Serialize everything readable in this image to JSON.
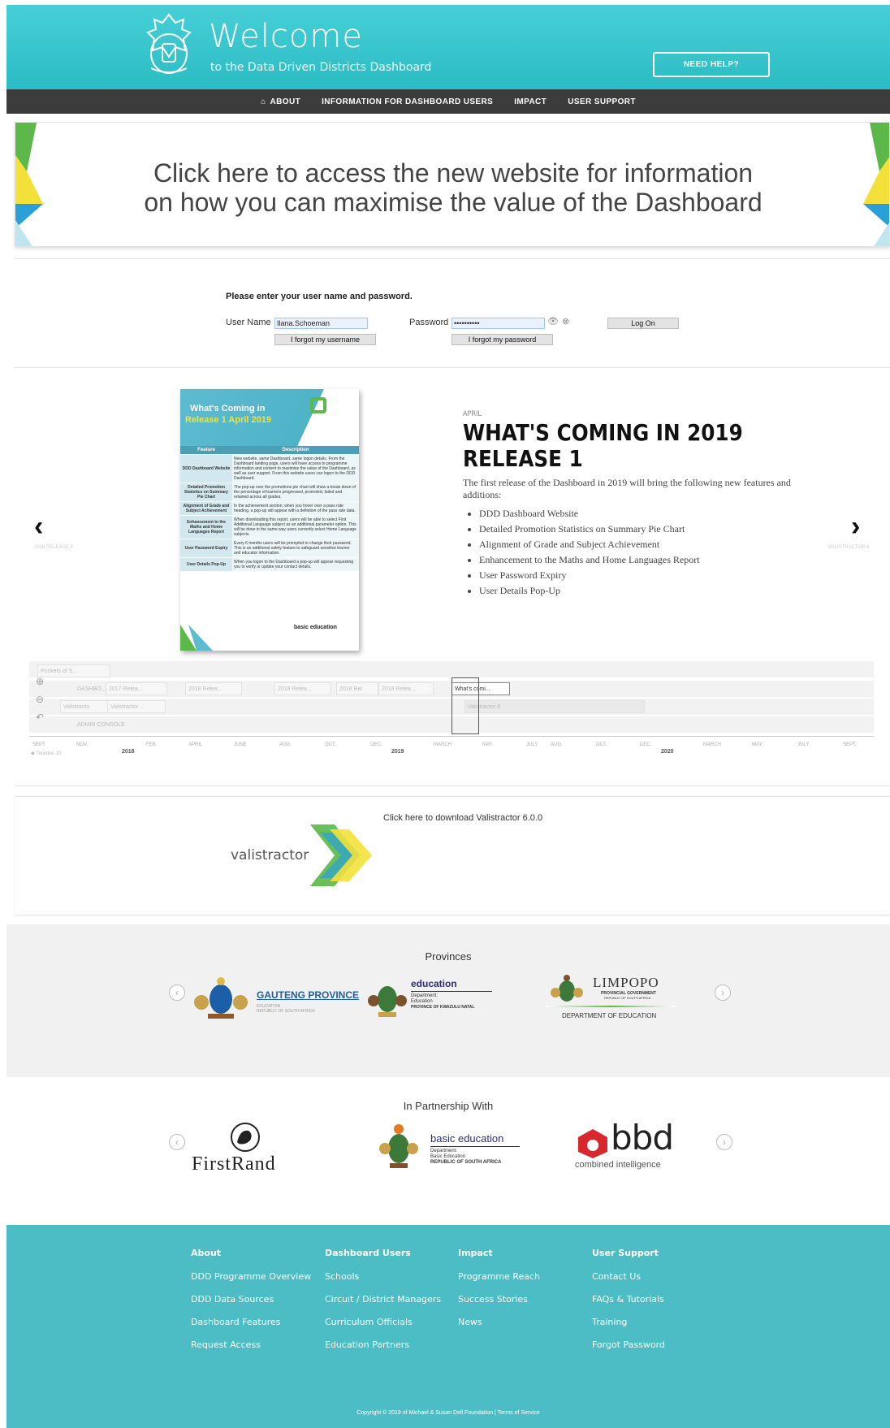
{
  "header": {
    "title": "Welcome",
    "subtitle": "to the Data Driven Districts Dashboard",
    "help_button": "NEED HELP?"
  },
  "nav": [
    "ABOUT",
    "INFORMATION FOR DASHBOARD USERS",
    "IMPACT",
    "USER SUPPORT"
  ],
  "banner": {
    "line1": "Click here to access the new website for information",
    "line2": "on how you can maximise the value of the Dashboard"
  },
  "login": {
    "prompt": "Please enter your user name and password.",
    "username_label": "User Name",
    "username_value": "Ilana.Schoeman",
    "password_label": "Password",
    "password_value": "••••••••••",
    "forgot_username": "I forgot my username",
    "forgot_password": "I forgot my password",
    "logon": "Log On"
  },
  "slide": {
    "date": "APRIL",
    "title": "WHAT'S COMING IN 2019 RELEASE 1",
    "intro": "The first release of the Dashboard in 2019 will bring the following new features and additions:",
    "items": [
      "DDD Dashboard Website",
      "Detailed Promotion Statistics on Summary Pie Chart",
      "Alignment of Grade and Subject Achievement",
      "Enhancement to the Maths and Home Languages Report",
      "User Password Expiry",
      "User Details Pop-Up"
    ],
    "prev_caption": "2018 RELEASE 3",
    "next_caption": "VALISTRACTOR 6",
    "prev_icon": "chevron-left",
    "next_icon": "chevron-right",
    "poster": {
      "title1": "What's Coming in",
      "title2": "Release 1 April 2019",
      "col1": "Feature",
      "col2": "Description",
      "rows": [
        {
          "f": "DDD Dashboard Website",
          "d": "New website, same Dashboard, same logon details. From the Dashboard landing page, users will have access to programme information and content to maximise the value of the Dashboard, as well as user support. From this website users can logon to the DDD Dashboard."
        },
        {
          "f": "Detailed Promotion Statistics on Summary Pie Chart",
          "d": "The pop-up over the promotions pie chart will show a break down of the percentage of learners progressed, promoted, failed and retained across all grades."
        },
        {
          "f": "Alignment of Grade and Subject Achievement",
          "d": "In the achievement section, when you hover over a pass rate heading, a pop-up will appear with a definition of the pass rate data."
        },
        {
          "f": "Enhancement to the Maths and Home Languages Report",
          "d": "When downloading this report, users will be able to select First Additional Language subject as an additional parameter option. This will be done in the same way users currently select Home Language subjects."
        },
        {
          "f": "User Password Expiry",
          "d": "Every 6 months users will be prompted to change their password. This is an additional safety feature to safeguard sensitive learner and educator information."
        },
        {
          "f": "User Details Pop-Up",
          "d": "When you logon to the Dashboard a pop-up will appear requesting you to verify or update your contact details."
        }
      ],
      "footer": "basic education"
    }
  },
  "timeline": {
    "groups": [
      "Pockets of S...",
      "DASHBO...",
      "ADMIN CONSOLE"
    ],
    "items": [
      "2017 Relea...",
      "2018 Relea...",
      "2018 Relea...",
      "2018 Rel",
      "2018 Relea...",
      "What's comi...",
      "Valistracto",
      "Valistractor ...",
      "Valistractor 6"
    ],
    "months": [
      "SEPT.",
      "NOV.",
      "FEB.",
      "APRIL",
      "JUNE",
      "AUG.",
      "OCT.",
      "DEC.",
      "MARCH",
      "MAY",
      "JULY",
      "AUG.",
      "OCT.",
      "DEC.",
      "MARCH",
      "MAY",
      "JULY",
      "SEPT."
    ],
    "years": [
      "2018",
      "2019",
      "2020"
    ],
    "credit": "Timeline JS"
  },
  "valistractor": {
    "link": "Click here to download Valistractor 6.0.0",
    "logo_text": "valistractor"
  },
  "provinces": {
    "title": "Provinces",
    "gauteng": "GAUTENG PROVINCE",
    "gauteng_sub1": "EDUCATION",
    "gauteng_sub2": "REPUBLIC OF SOUTH AFRICA",
    "kzn": "education",
    "kzn_sub1": "Department:",
    "kzn_sub2": "Education",
    "kzn_sub3": "PROVINCE OF KWAZULU NATAL",
    "limpopo": "LIMPOPO",
    "limpopo_sub1": "PROVINCIAL GOVERNMENT",
    "limpopo_sub2": "REPUBLIC OF SOUTH AFRICA",
    "limpopo_sub3": "DEPARTMENT OF EDUCATION"
  },
  "partners": {
    "title": "In Partnership With",
    "firstrand": "FirstRand",
    "dbe": "basic education",
    "dbe_sub1": "Department:",
    "dbe_sub2": "Basic Education",
    "dbe_sub3": "REPUBLIC OF SOUTH AFRICA",
    "bbd": "bbd",
    "bbd_sub": "combined intelligence"
  },
  "footer": {
    "columns": [
      {
        "heading": "About",
        "links": [
          "DDD Programme Overview",
          "DDD Data Sources",
          "Dashboard Features",
          "Request Access"
        ]
      },
      {
        "heading": "Dashboard Users",
        "links": [
          "Schools",
          "Circuit / District Managers",
          "Curriculum Officials",
          "Education Partners"
        ]
      },
      {
        "heading": "Impact",
        "links": [
          "Programme Reach",
          "Success Stories",
          "News"
        ]
      },
      {
        "heading": "User Support",
        "links": [
          "Contact Us",
          "FAQs & Tutorials",
          "Training",
          "Forgot Password"
        ]
      }
    ],
    "copyright": "Copyright © 2019 of Michael & Susan Dell Foundation | Terms of Service"
  },
  "colors": {
    "brand_teal": "#2cbcc4",
    "nav_dark": "#3c3c3c",
    "footer_teal": "#4cbcc5"
  }
}
